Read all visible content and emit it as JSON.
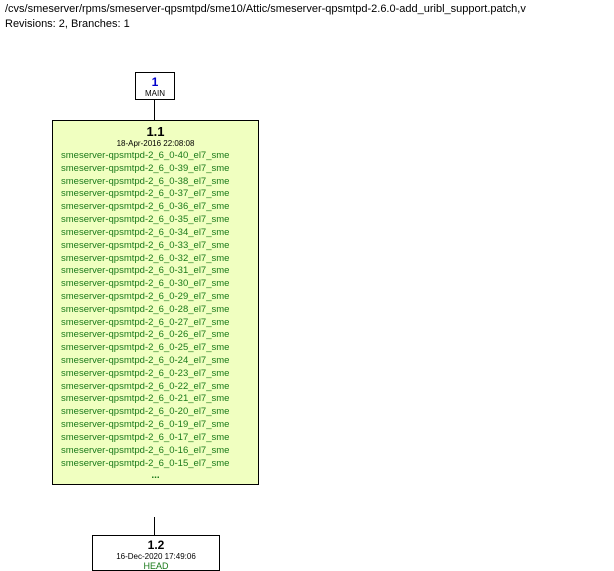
{
  "header": {
    "path": "/cvs/smeserver/rpms/smeserver-qpsmtpd/sme10/Attic/smeserver-qpsmtpd-2.6.0-add_uribl_support.patch,v",
    "revisions": "Revisions: 2, Branches: 1"
  },
  "nodes": {
    "main": {
      "number": "1",
      "label": "MAIN"
    },
    "v11": {
      "version": "1.1",
      "date": "18-Apr-2016 22:08:08",
      "tags": [
        "smeserver-qpsmtpd-2_6_0-40_el7_sme",
        "smeserver-qpsmtpd-2_6_0-39_el7_sme",
        "smeserver-qpsmtpd-2_6_0-38_el7_sme",
        "smeserver-qpsmtpd-2_6_0-37_el7_sme",
        "smeserver-qpsmtpd-2_6_0-36_el7_sme",
        "smeserver-qpsmtpd-2_6_0-35_el7_sme",
        "smeserver-qpsmtpd-2_6_0-34_el7_sme",
        "smeserver-qpsmtpd-2_6_0-33_el7_sme",
        "smeserver-qpsmtpd-2_6_0-32_el7_sme",
        "smeserver-qpsmtpd-2_6_0-31_el7_sme",
        "smeserver-qpsmtpd-2_6_0-30_el7_sme",
        "smeserver-qpsmtpd-2_6_0-29_el7_sme",
        "smeserver-qpsmtpd-2_6_0-28_el7_sme",
        "smeserver-qpsmtpd-2_6_0-27_el7_sme",
        "smeserver-qpsmtpd-2_6_0-26_el7_sme",
        "smeserver-qpsmtpd-2_6_0-25_el7_sme",
        "smeserver-qpsmtpd-2_6_0-24_el7_sme",
        "smeserver-qpsmtpd-2_6_0-23_el7_sme",
        "smeserver-qpsmtpd-2_6_0-22_el7_sme",
        "smeserver-qpsmtpd-2_6_0-21_el7_sme",
        "smeserver-qpsmtpd-2_6_0-20_el7_sme",
        "smeserver-qpsmtpd-2_6_0-19_el7_sme",
        "smeserver-qpsmtpd-2_6_0-17_el7_sme",
        "smeserver-qpsmtpd-2_6_0-16_el7_sme",
        "smeserver-qpsmtpd-2_6_0-15_el7_sme"
      ],
      "ellipsis": "..."
    },
    "v12": {
      "version": "1.2",
      "date": "16-Dec-2020 17:49:06",
      "head": "HEAD"
    }
  }
}
